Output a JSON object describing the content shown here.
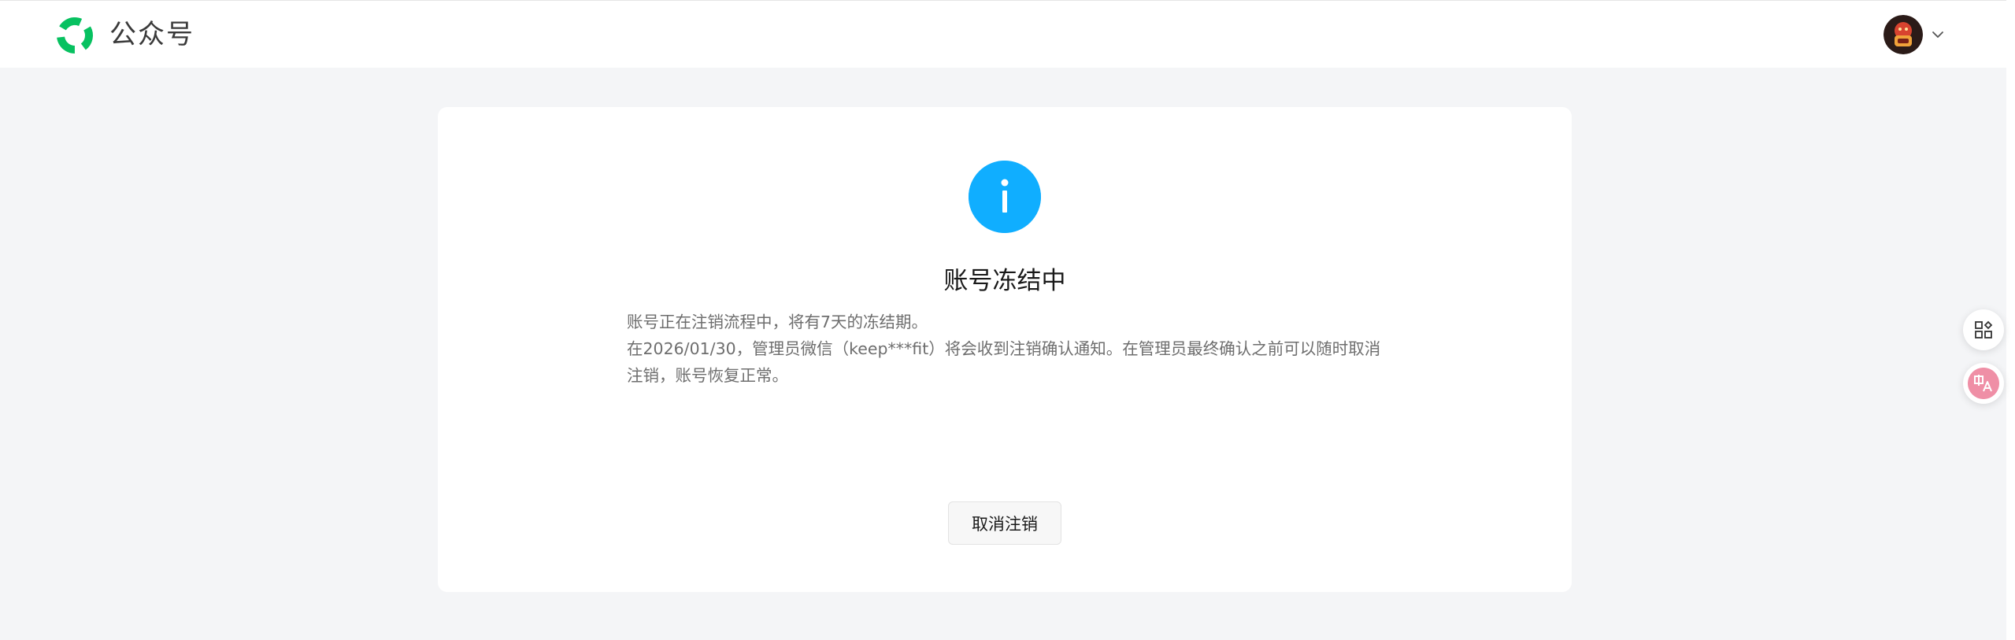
{
  "header": {
    "brand_name": "公众号",
    "logo_icon": "wechat-official-account-logo-icon",
    "avatar_icon": "user-avatar",
    "menu_icon": "chevron-down-icon"
  },
  "status": {
    "icon": "info-icon",
    "title": "账号冻结中",
    "description_lines": [
      "账号正在注销流程中，将有7天的冻结期。",
      "在2026/01/30，管理员微信（keep***fit）将会收到注销确认通知。在管理员最终确认之前可以随时取消注销，账号恢复正常。"
    ],
    "cancel_button_label": "取消注销"
  },
  "floating_tools": {
    "grid_icon": "app-grid-icon",
    "translate_icon": "translate-icon"
  },
  "colors": {
    "page_background": "#f4f5f7",
    "info_blue": "#10aeff",
    "brand_green": "#07c160",
    "text_primary": "#191919",
    "text_secondary": "#6e6e6e"
  }
}
